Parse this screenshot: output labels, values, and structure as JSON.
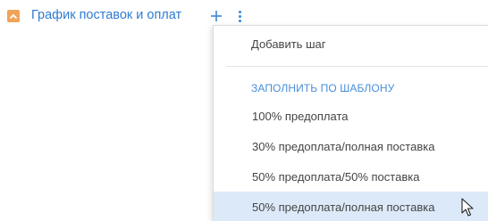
{
  "header": {
    "section_title": "График поставок и оплат"
  },
  "menu": {
    "add_step": "Добавить шаг",
    "group_header": "ЗАПОЛНИТЬ ПО ШАБЛОНУ",
    "templates": [
      "100% предоплата",
      "30% предоплата/полная поставка",
      "50% предоплата/50% поставка",
      "50% предоплата/полная поставка"
    ],
    "highlighted_index": 3
  },
  "colors": {
    "accent": "#2f7bd1",
    "toggle": "#f0a45a",
    "highlight": "#dce9f8"
  },
  "icons": {
    "collapse": "chevron-up-icon",
    "add": "plus-icon",
    "more": "more-vertical-icon",
    "cursor": "mouse-pointer-icon"
  }
}
